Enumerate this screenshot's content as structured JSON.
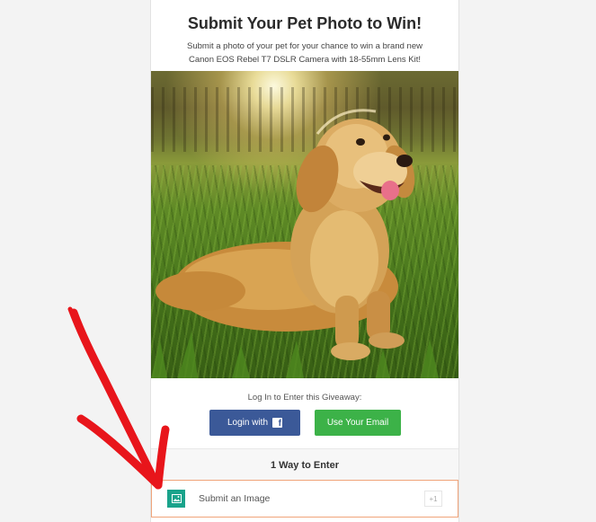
{
  "giveaway": {
    "title": "Submit Your Pet Photo to Win!",
    "description_line1": "Submit a photo of your pet for your chance to win a brand new",
    "description_line2": "Canon EOS Rebel T7 DSLR Camera with 18-55mm Lens Kit!",
    "photo_icon": "dog-photo"
  },
  "login": {
    "label": "Log In to Enter this Giveaway:",
    "facebook_button": "Login with",
    "facebook_icon": "facebook-icon",
    "email_button": "Use Your Email"
  },
  "entries": {
    "header": "1 Way to Enter",
    "items": [
      {
        "label": "Submit an Image",
        "icon": "image-icon",
        "points": "+1"
      }
    ]
  },
  "colors": {
    "facebook": "#3b5998",
    "email": "#3cb248",
    "entry_icon": "#19a38b",
    "highlight_border": "#f0a47a",
    "annotation_arrow": "#e8151b"
  }
}
